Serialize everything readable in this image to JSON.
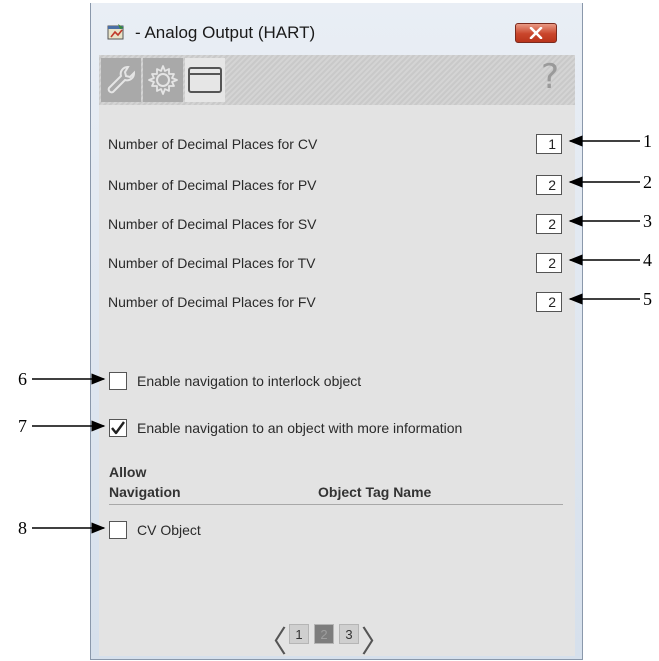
{
  "window": {
    "title": "- Analog Output (HART)",
    "close_icon": "close-icon",
    "app_icon": "app-icon"
  },
  "tabs": [
    {
      "name": "maintenance",
      "icon": "wrench-icon",
      "active": false
    },
    {
      "name": "engineering",
      "icon": "gear-icon",
      "active": false
    },
    {
      "name": "hmi-config",
      "icon": "window-icon",
      "active": true
    }
  ],
  "help": {
    "label": "?"
  },
  "decimal_rows": [
    {
      "label": "Number of Decimal Places for CV",
      "value": "1"
    },
    {
      "label": "Number of Decimal Places for PV",
      "value": "2"
    },
    {
      "label": "Number of Decimal Places for SV",
      "value": "2"
    },
    {
      "label": "Number of Decimal Places for TV",
      "value": "2"
    },
    {
      "label": "Number of Decimal Places for FV",
      "value": "2"
    }
  ],
  "options": {
    "interlock_nav": {
      "label": "Enable navigation to interlock object",
      "checked": false
    },
    "info_nav": {
      "label": "Enable navigation to an object with more information",
      "checked": true
    }
  },
  "navigation_table": {
    "col_allow_line1": "Allow",
    "col_allow_line2": "Navigation",
    "col_tag": "Object Tag Name",
    "rows": [
      {
        "label": "CV Object",
        "checked": false
      }
    ]
  },
  "pager": {
    "prev": "〈",
    "next": "〉",
    "pages": [
      "1",
      "2",
      "3"
    ],
    "current": "2"
  },
  "callouts": [
    "1",
    "2",
    "3",
    "4",
    "5",
    "6",
    "7",
    "8"
  ]
}
